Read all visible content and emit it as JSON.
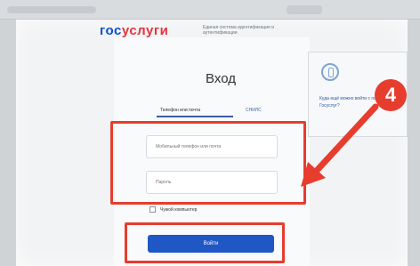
{
  "brand": {
    "part1": "гос",
    "part2": "услуги",
    "tagline": "Единая система идентификации и аутентификации"
  },
  "login": {
    "title": "Вход",
    "tabs": [
      "Телефон или почта",
      "СНИЛС"
    ],
    "login_placeholder": "Мобильный телефон или почта",
    "password_placeholder": "Пароль",
    "remember_label": "Чужой компьютер",
    "submit_label": "Войти"
  },
  "side_card": {
    "text": "Куда ещё можно войти с паролем от Госуслуг?"
  },
  "annotation": {
    "step": "4",
    "color": "#e63d2e"
  },
  "colors": {
    "brand_blue": "#0d4cd3",
    "brand_red": "#e3343d",
    "button": "#1f58c5"
  }
}
